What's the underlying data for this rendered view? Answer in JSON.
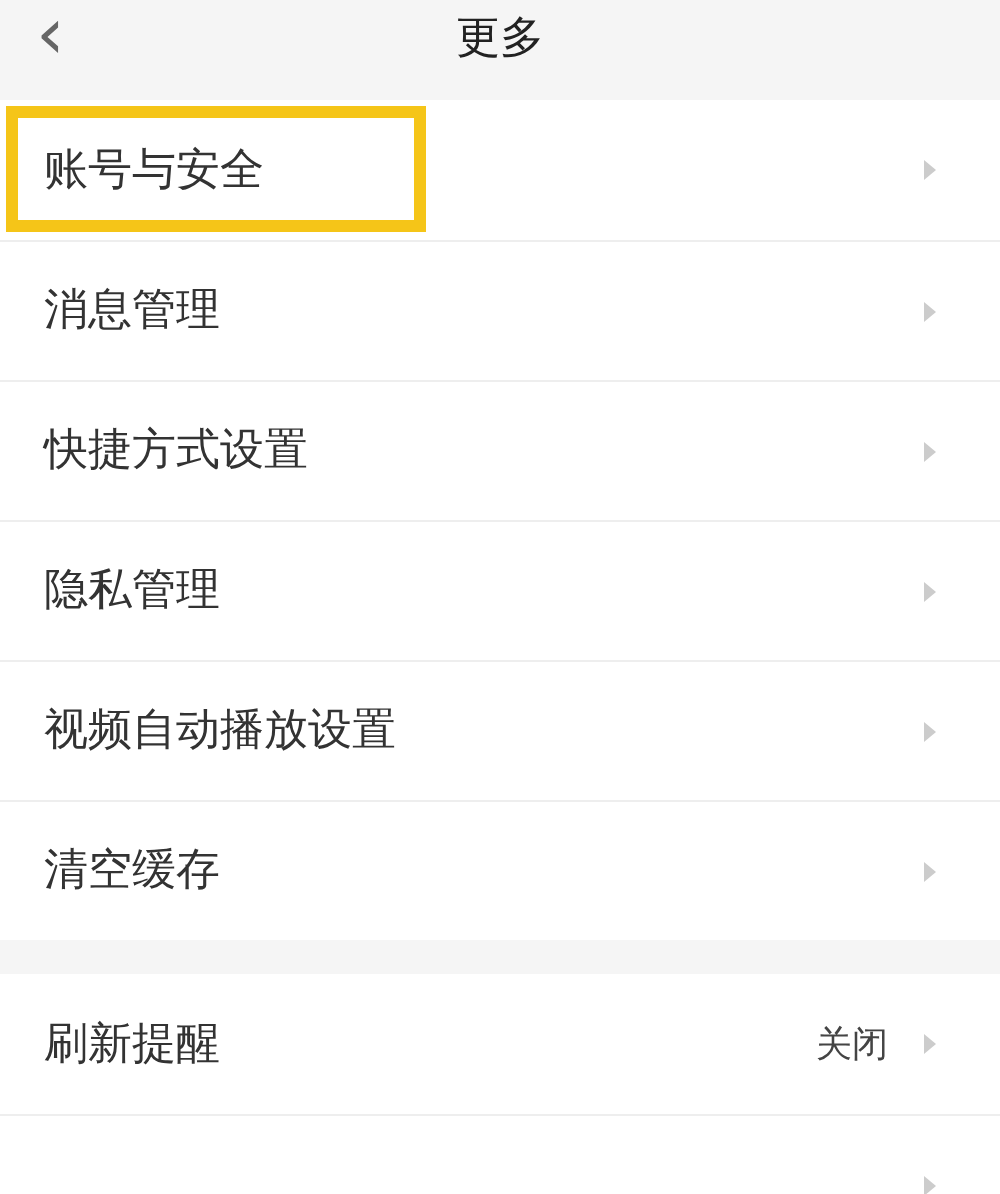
{
  "header": {
    "back_icon": "‹",
    "title": "更多"
  },
  "sections": [
    {
      "rows": [
        {
          "label": "账号与安全",
          "highlighted": true
        },
        {
          "label": "消息管理",
          "highlighted": false
        },
        {
          "label": "快捷方式设置",
          "highlighted": false
        },
        {
          "label": "隐私管理",
          "highlighted": false
        },
        {
          "label": "视频自动播放设置",
          "highlighted": false
        },
        {
          "label": "清空缓存",
          "highlighted": false
        }
      ]
    },
    {
      "rows": [
        {
          "label": "刷新提醒",
          "value": "关闭",
          "highlighted": false
        },
        {
          "highlighted": false
        }
      ]
    }
  ]
}
